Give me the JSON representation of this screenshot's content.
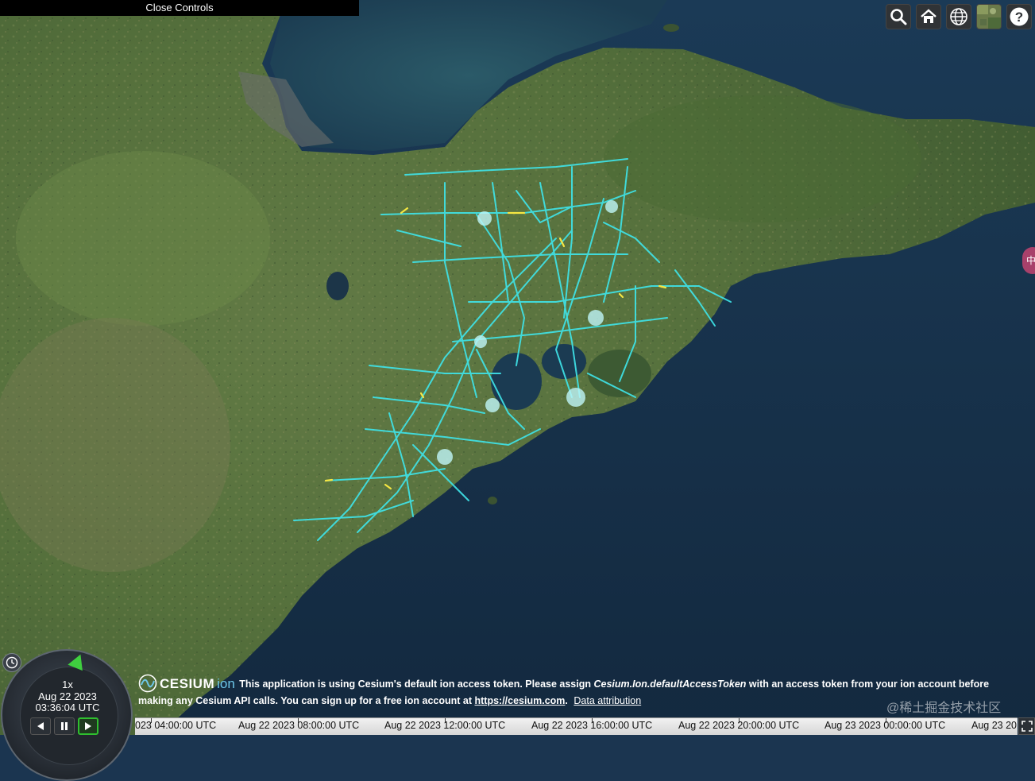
{
  "controls": {
    "close_label": "Close Controls"
  },
  "toolbar": {
    "buttons": [
      {
        "name": "search-button",
        "icon": "search-icon"
      },
      {
        "name": "home-button",
        "icon": "home-icon"
      },
      {
        "name": "scene-mode-button",
        "icon": "globe-icon"
      },
      {
        "name": "base-layer-picker-button",
        "icon": "imagery-thumbnail-icon"
      },
      {
        "name": "help-button",
        "icon": "question-icon"
      }
    ]
  },
  "animation": {
    "speed": "1x",
    "date": "Aug 22 2023",
    "time": "03:36:04 UTC"
  },
  "credits": {
    "logo_word": "CESIUM",
    "logo_ion": "ion",
    "message_before": "This application is using Cesium's default ion access token. Please assign ",
    "message_code": "Cesium.Ion.defaultAccessToken",
    "message_after": " with an access token from your ion account before making any Cesium API calls. You can sign up for a free ion account at ",
    "link": "https://cesium.com",
    "link_suffix": ".",
    "attribution": "Data attribution"
  },
  "watermark": "@稀土掘金技术社区",
  "side_pill": "中",
  "timeline": {
    "labels": [
      "023 04:00:00 UTC",
      "Aug 22 2023 08:00:00 UTC",
      "Aug 22 2023 12:00:00 UTC",
      "Aug 22 2023 16:00:00 UTC",
      "Aug 22 2023 20:00:00 UTC",
      "Aug 23 2023 00:00:00 UTC",
      "Aug 23 20"
    ]
  },
  "colors": {
    "road_network": "#3fe3e8",
    "road_highlight": "#f5e642",
    "sea": "#17324d",
    "land": "#4f6a3a",
    "toolbar_bg": "#303336"
  }
}
